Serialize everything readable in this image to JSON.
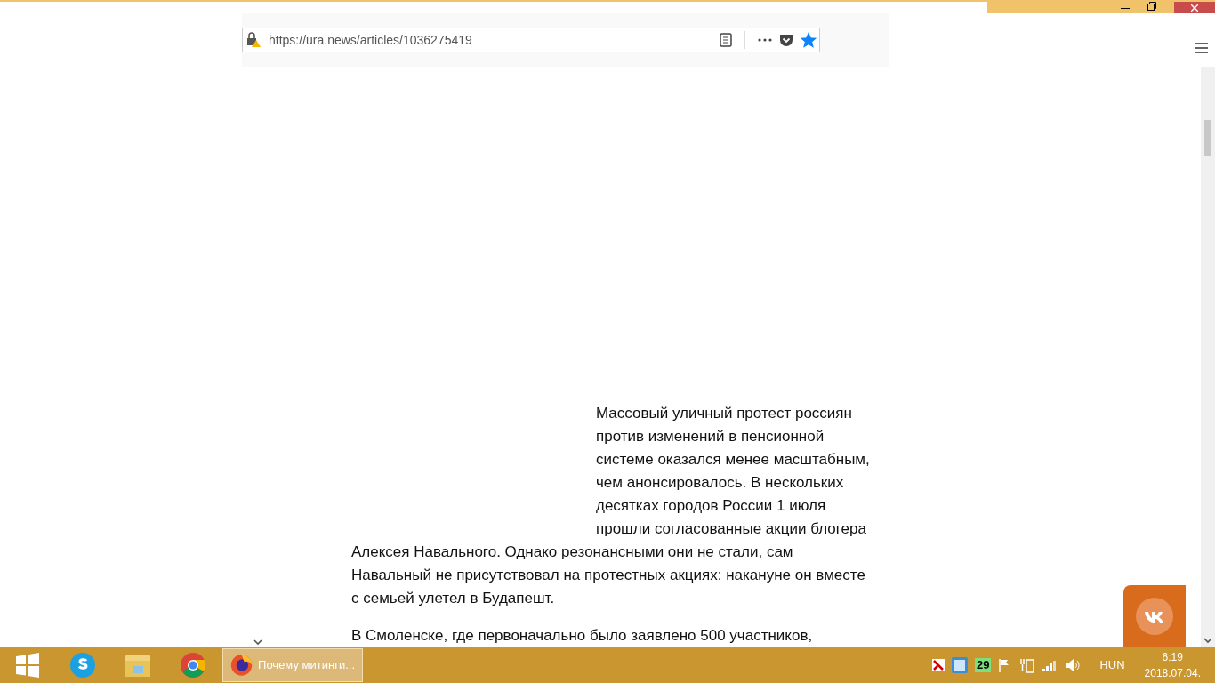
{
  "browser": {
    "url": "https://ura.news/articles/1036275419",
    "bookmarked": true
  },
  "article": {
    "paragraphs": [
      "Массовый уличный протест россиян против изменений в пенсионной системе оказался менее масштабным, чем анонсировалось. В нескольких десятках городов России 1 июля прошли согласованные акции блогера Алексея Навального. Однако резонансными они не стали, сам Навальный не присутствовал на протестных акциях: накануне он вместе с семьей улетел в Будапешт.",
      "В Смоленске, где первоначально было заявлено 500 участников,"
    ]
  },
  "taskbar": {
    "pinned": [
      {
        "kind": "start"
      },
      {
        "kind": "skype"
      },
      {
        "kind": "explorer"
      },
      {
        "kind": "chrome"
      }
    ],
    "window_button": {
      "label": "Почему митинги...",
      "selected": true
    },
    "tray": {
      "badge": "29",
      "language": "HUN",
      "time": "6:19",
      "date": "2018.07.04."
    }
  }
}
